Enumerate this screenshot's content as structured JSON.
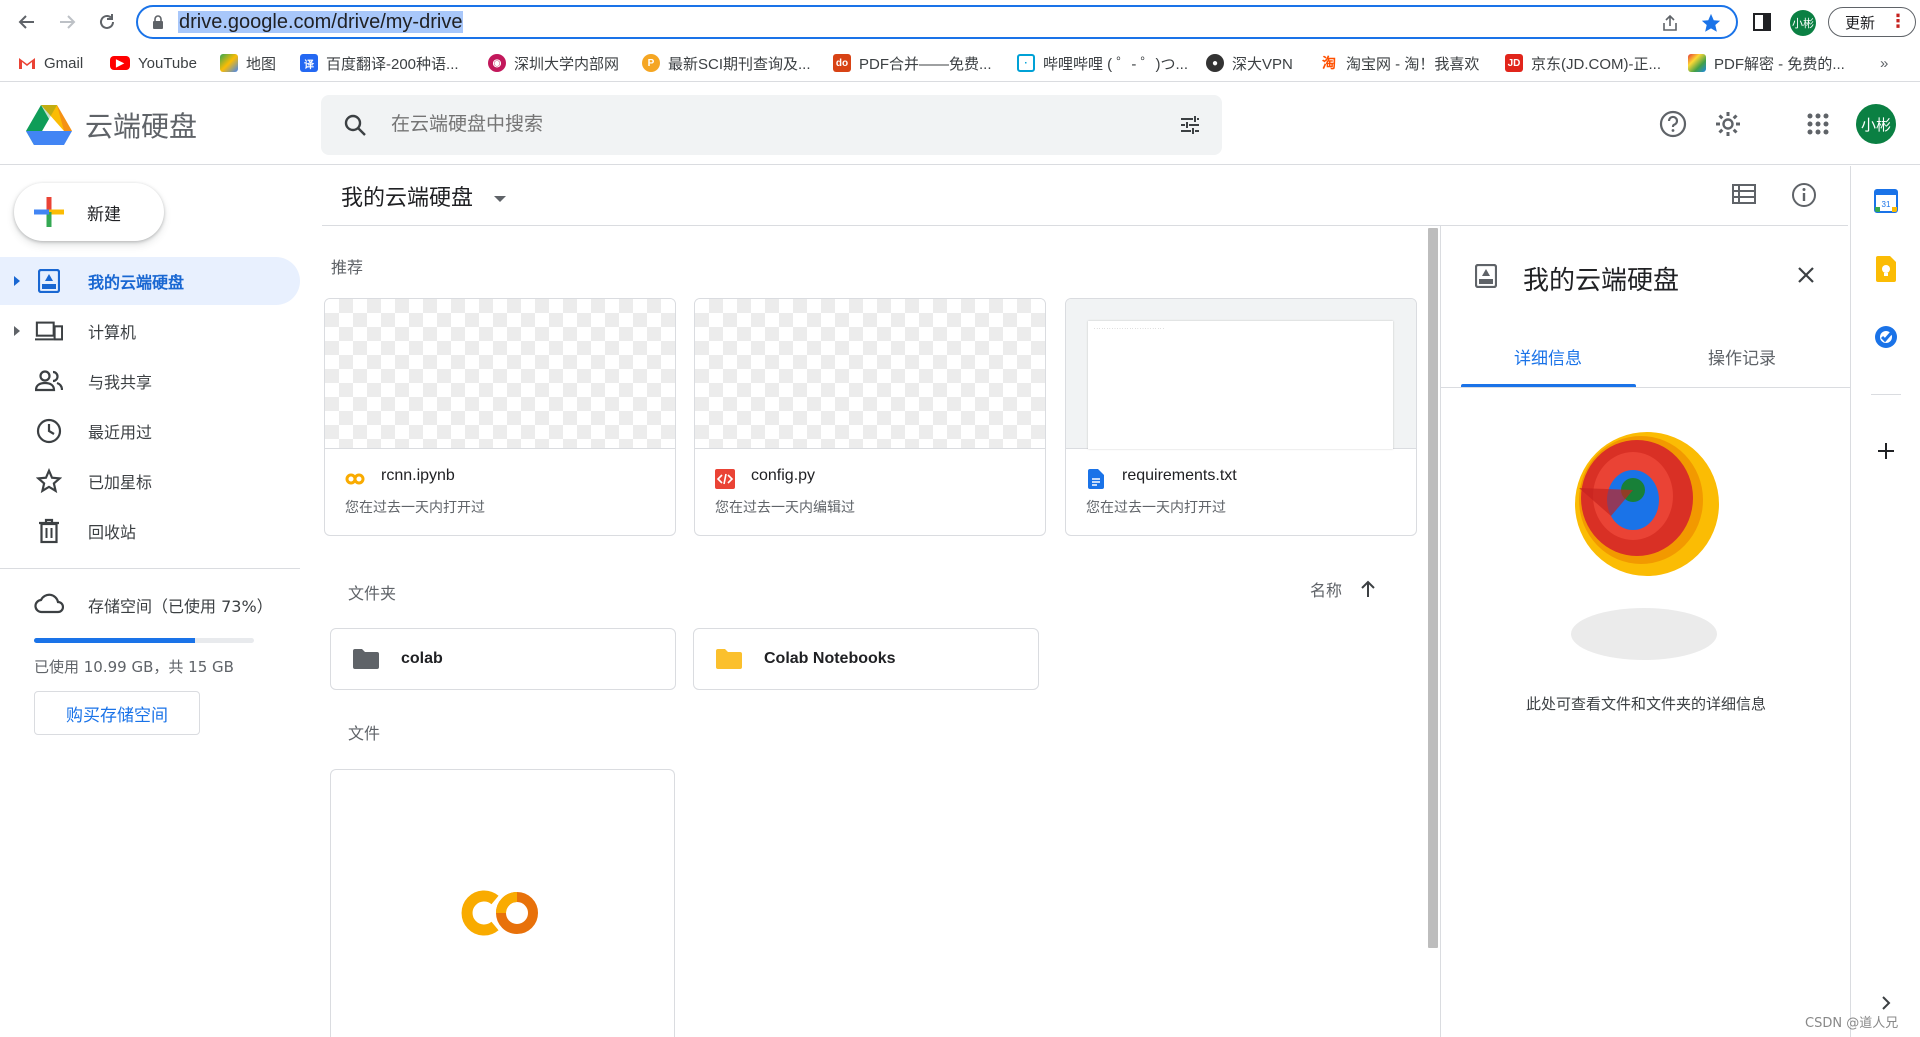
{
  "browser": {
    "url": "drive.google.com/drive/my-drive",
    "profile": "小彬",
    "update_label": "更新"
  },
  "bookmarks": [
    {
      "label": "Gmail",
      "icon": "gmail-icon",
      "color": "#ea4335"
    },
    {
      "label": "YouTube",
      "icon": "youtube-icon",
      "color": "#ff0000"
    },
    {
      "label": "地图",
      "icon": "maps-icon",
      "color": "#34a853"
    },
    {
      "label": "百度翻译-200种语...",
      "icon": "baidu-translate-icon",
      "color": "#2468f2"
    },
    {
      "label": "深圳大学内部网",
      "icon": "szu-icon",
      "color": "#c2185b"
    },
    {
      "label": "最新SCI期刊查询及...",
      "icon": "sci-icon",
      "color": "#f5a623"
    },
    {
      "label": "PDF合并——免费...",
      "icon": "pdf-merge-icon",
      "color": "#d84315"
    },
    {
      "label": "哔哩哔哩 ( ゜- ゜)つ...",
      "icon": "bilibili-icon",
      "color": "#00a1d6"
    },
    {
      "label": "深大VPN",
      "icon": "vpn-icon",
      "color": "#333333"
    },
    {
      "label": "淘宝网 - 淘！我喜欢",
      "icon": "taobao-icon",
      "color": "#ff5000"
    },
    {
      "label": "京东(JD.COM)-正...",
      "icon": "jd-icon",
      "color": "#e1251b"
    },
    {
      "label": "PDF解密 - 免费的...",
      "icon": "pdf-decrypt-icon",
      "color": "#7b1fa2"
    }
  ],
  "header": {
    "app_name": "云端硬盘",
    "search_placeholder": "在云端硬盘中搜索"
  },
  "sidebar": {
    "new_label": "新建",
    "items": [
      {
        "label": "我的云端硬盘",
        "icon": "my-drive-icon",
        "active": true
      },
      {
        "label": "计算机",
        "icon": "computers-icon"
      },
      {
        "label": "与我共享",
        "icon": "shared-icon"
      },
      {
        "label": "最近用过",
        "icon": "recent-icon"
      },
      {
        "label": "已加星标",
        "icon": "star-icon"
      },
      {
        "label": "回收站",
        "icon": "trash-icon"
      }
    ],
    "storage_label": "存储空间（已使用 73%）",
    "storage_percent": 73,
    "storage_text": "已使用 10.99 GB，共 15 GB",
    "buy_label": "购买存储空间"
  },
  "main": {
    "title": "我的云端硬盘",
    "recommended_label": "推荐",
    "recommended": [
      {
        "name": "rcnn.ipynb",
        "sub": "您在过去一天内打开过",
        "icon": "colab-icon"
      },
      {
        "name": "config.py",
        "sub": "您在过去一天内编辑过",
        "icon": "code-file-icon"
      },
      {
        "name": "requirements.txt",
        "sub": "您在过去一天内打开过",
        "icon": "doc-file-icon"
      }
    ],
    "folders_label": "文件夹",
    "sort_label": "名称",
    "folders": [
      {
        "name": "colab",
        "color": "#5f6368"
      },
      {
        "name": "Colab Notebooks",
        "color": "#fbc02d"
      }
    ],
    "files_label": "文件"
  },
  "details": {
    "title": "我的云端硬盘",
    "tab_details": "详细信息",
    "tab_activity": "操作记录",
    "message": "此处可查看文件和文件夹的详细信息"
  },
  "watermark": "CSDN @道人兄"
}
